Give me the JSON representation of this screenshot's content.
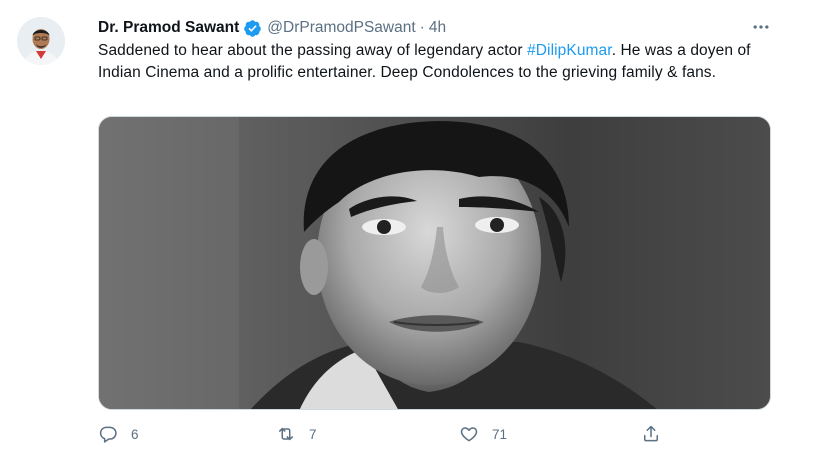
{
  "tweet": {
    "author_name": "Dr. Pramod Sawant",
    "handle": "@DrPramodPSawant",
    "separator": "·",
    "time": "4h",
    "text_before": "Saddened to hear about the passing away of legendary actor ",
    "hashtag": "#DilipKumar",
    "text_after": ". He was a doyen of Indian Cinema and a prolific entertainer. Deep Condolences to the grieving family & fans."
  },
  "icons": {
    "verified": "verified-badge-icon",
    "more": "more-horizontal-icon",
    "reply": "reply-icon",
    "retweet": "retweet-icon",
    "like": "heart-icon",
    "share": "share-icon"
  },
  "actions": {
    "replies": "6",
    "retweets": "7",
    "likes": "71"
  },
  "colors": {
    "accent": "#1d9bf0",
    "secondary_text": "#5b7083"
  }
}
